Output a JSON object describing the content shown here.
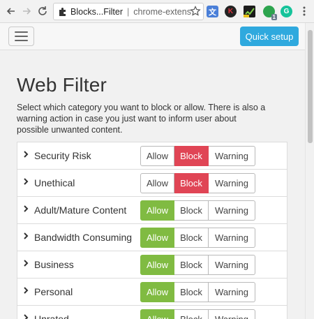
{
  "browser": {
    "tab_title": "Blocks...Filter",
    "url": "chrome-extens",
    "icons": [
      "back-arrow-icon",
      "forward-arrow-icon",
      "reload-icon",
      "puzzle-icon",
      "star-icon",
      "translate-icon",
      "kaspersky-icon",
      "checkmark-icon",
      "grammarly-icon",
      "menu-dots-icon"
    ],
    "ext_letters": {
      "k": "K",
      "g": "G",
      "badge": "1"
    }
  },
  "header": {
    "quick_setup_label": "Quick setup"
  },
  "main": {
    "title": "Web Filter",
    "description": "Select which category you want to block or allow. There is also a warning action in case you just want to inform user about possible unwanted content.",
    "button_labels": {
      "allow": "Allow",
      "block": "Block",
      "warning": "Warning"
    },
    "categories": [
      {
        "label": "Security Risk",
        "selected": "block"
      },
      {
        "label": "Unethical",
        "selected": "block"
      },
      {
        "label": "Adult/Mature Content",
        "selected": "allow"
      },
      {
        "label": "Bandwidth Consuming",
        "selected": "allow"
      },
      {
        "label": "Business",
        "selected": "allow"
      },
      {
        "label": "Personal",
        "selected": "allow"
      },
      {
        "label": "Unrated",
        "selected": "allow"
      }
    ]
  },
  "colors": {
    "block_active": "#e04555",
    "allow_active": "#80bb42",
    "quick_setup": "#2fa9de"
  }
}
